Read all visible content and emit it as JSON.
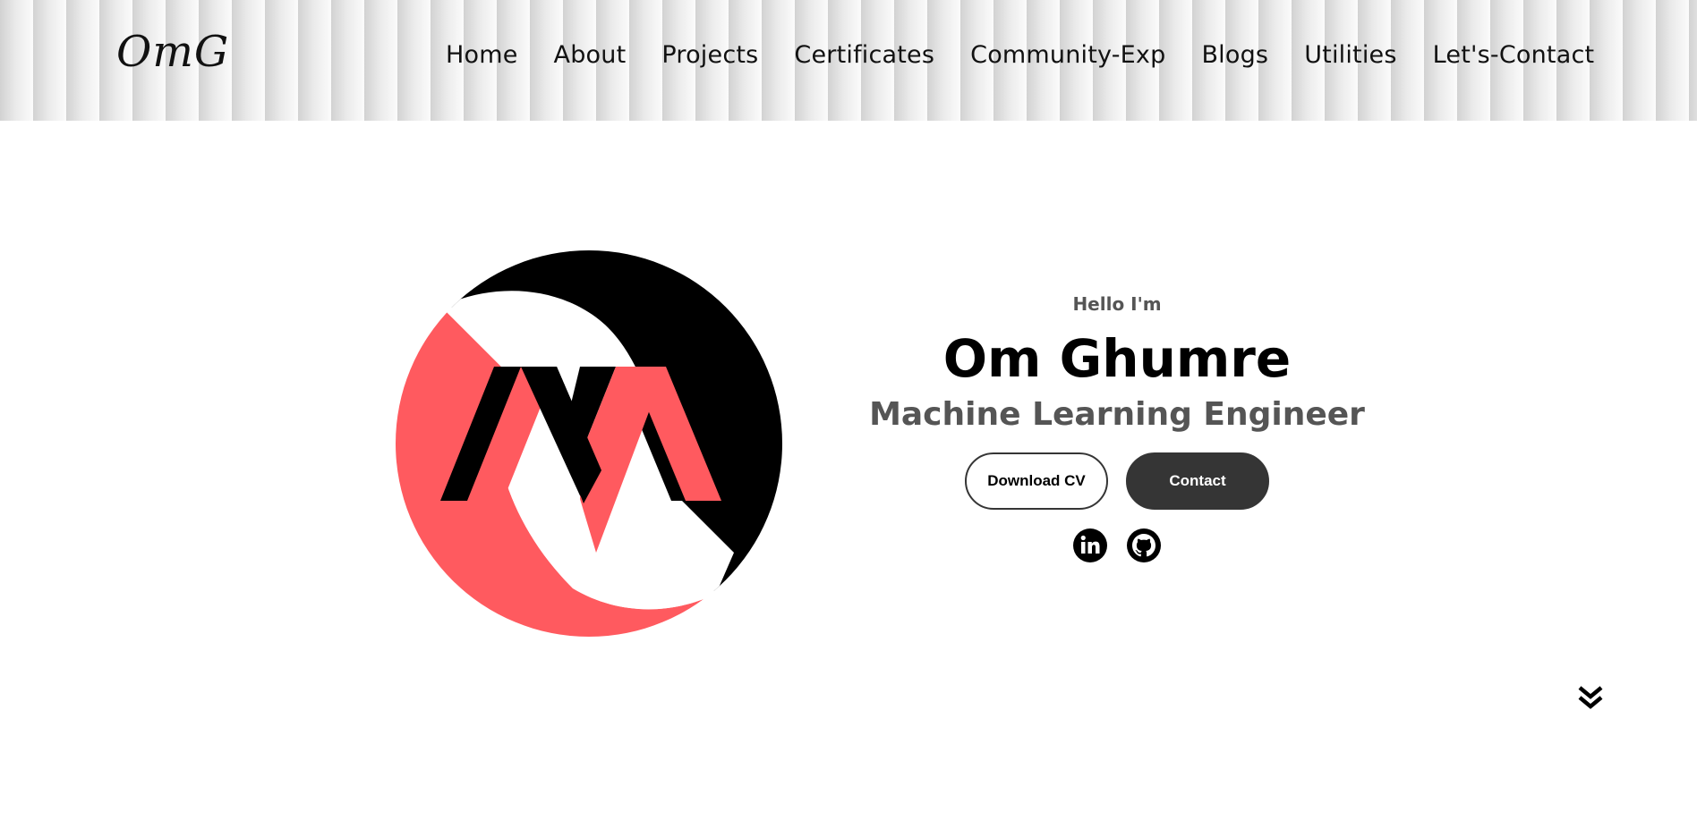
{
  "header": {
    "logo_text": "OmG",
    "nav": [
      {
        "label": "Home"
      },
      {
        "label": "About"
      },
      {
        "label": "Projects"
      },
      {
        "label": "Certificates"
      },
      {
        "label": "Community-Exp"
      },
      {
        "label": "Blogs"
      },
      {
        "label": "Utilities"
      },
      {
        "label": "Let's-Contact"
      }
    ]
  },
  "hero": {
    "logo_icon": "om-monogram-logo",
    "greeting": "Hello I'm",
    "name": "Om Ghumre",
    "role": "Machine Learning Engineer",
    "buttons": {
      "download_cv": "Download CV",
      "contact": "Contact"
    },
    "social": [
      {
        "icon": "linkedin-icon"
      },
      {
        "icon": "github-icon"
      }
    ]
  },
  "scroll_icon": "double-chevron-down-icon",
  "colors": {
    "accent": "#ff5a5f",
    "dark": "#353535",
    "text_muted": "#555555",
    "black": "#000000"
  }
}
